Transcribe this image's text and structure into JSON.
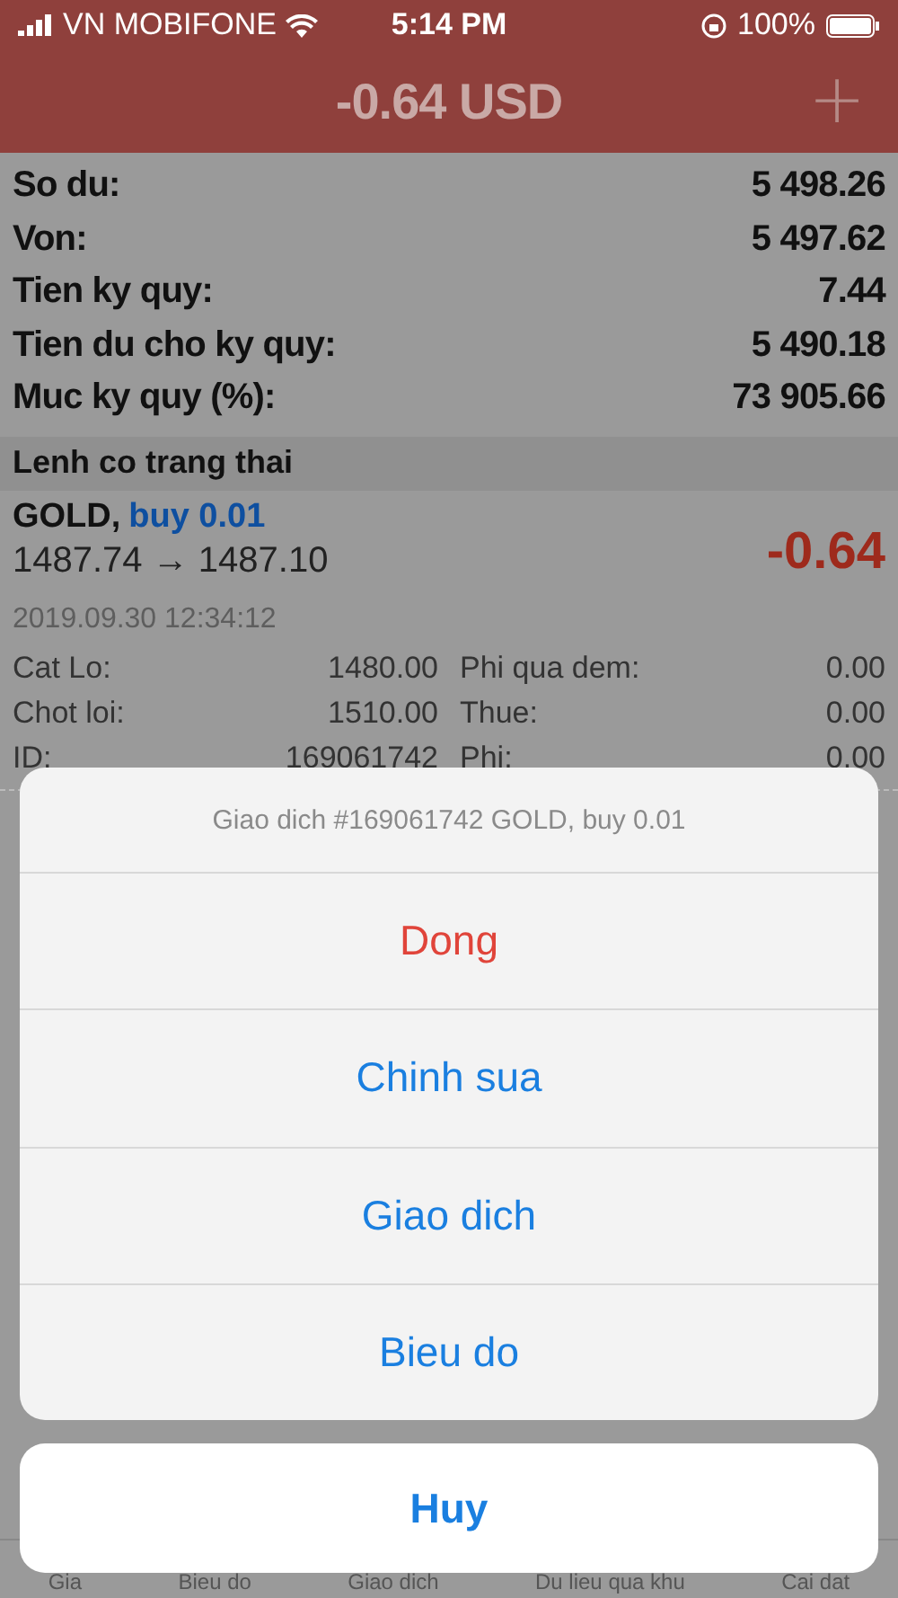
{
  "status_bar": {
    "carrier": "VN MOBIFONE",
    "time": "5:14 PM",
    "battery": "100%"
  },
  "header": {
    "title": "-0.64 USD",
    "add_button": "+"
  },
  "account": [
    {
      "label": "So du:",
      "value": "5 498.26"
    },
    {
      "label": "Von:",
      "value": "5 497.62"
    },
    {
      "label": "Tien ky quy:",
      "value": "7.44"
    },
    {
      "label": "Tien du cho ky quy:",
      "value": "5 490.18"
    },
    {
      "label": "Muc ky quy (%):",
      "value": "73 905.66"
    }
  ],
  "section_title": "Lenh co trang thai",
  "position": {
    "symbol": "GOLD,",
    "side": "buy 0.01",
    "prices": "1487.74 → 1487.10",
    "profit": "-0.64",
    "time": "2019.09.30 12:34:12",
    "details": [
      {
        "label": "Cat Lo:",
        "value": "1480.00"
      },
      {
        "label": "Phi qua dem:",
        "value": "0.00"
      },
      {
        "label": "Chot loi:",
        "value": "1510.00"
      },
      {
        "label": "Thue:",
        "value": "0.00"
      },
      {
        "label": "ID:",
        "value": "169061742"
      },
      {
        "label": "Phi:",
        "value": "0.00"
      }
    ]
  },
  "tab_bar": [
    "Gia",
    "Bieu do",
    "Giao dich",
    "Du lieu qua khu",
    "Cai dat"
  ],
  "action_sheet": {
    "title": "Giao dich #169061742 GOLD, buy 0.01",
    "actions": [
      {
        "label": "Dong",
        "kind": "destructive"
      },
      {
        "label": "Chinh sua",
        "kind": "default"
      },
      {
        "label": "Giao dich",
        "kind": "default"
      },
      {
        "label": "Bieu do",
        "kind": "default"
      }
    ],
    "cancel": "Huy"
  }
}
